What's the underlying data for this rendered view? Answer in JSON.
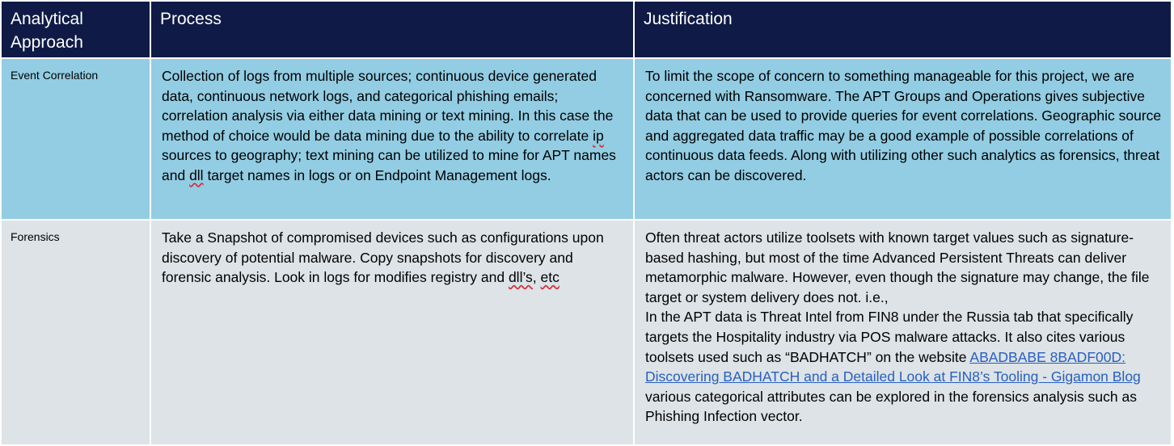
{
  "header": {
    "col1": "Analytical Approach",
    "col2": "Process",
    "col3": "Justification"
  },
  "rows": [
    {
      "approach": "Event Correlation",
      "process": {
        "p1": "Collection of logs from multiple sources; continuous device generated data, continuous network logs, and categorical phishing emails; correlation analysis via either data mining or text mining. In this case the method of choice would be data mining due to the ability to correlate ",
        "ip": "ip",
        "p2": " sources to geography; text mining can be utilized to mine for APT names and ",
        "dll": "dll",
        "p3": " target names in logs or on Endpoint Management logs."
      },
      "justification": "To limit the scope of concern to something manageable for this project, we are concerned with Ransomware. The APT Groups and Operations gives subjective data that can be used to provide queries for event correlations. Geographic source and aggregated data traffic may be a good example of possible correlations of continuous data feeds. Along with utilizing other such analytics as forensics, threat actors can be discovered."
    },
    {
      "approach": "Forensics",
      "process": {
        "p1": "Take a Snapshot of compromised devices such as configurations upon discovery of potential malware. Copy snapshots for discovery and forensic analysis. Look in logs for modifies registry and ",
        "dlls": "dll’s",
        "p2": ", ",
        "etc": "etc"
      },
      "justification": {
        "p1": "Often threat actors utilize toolsets with known target values such as signature-based hashing, but most of the time Advanced Persistent Threats can deliver metamorphic malware. However, even though the signature may change, the file target or system delivery does not. i.e.,",
        "p2": "In the APT data is Threat Intel from FIN8 under the Russia tab that specifically targets the Hospitality industry via POS malware attacks. It also cites various toolsets used such as “BADHATCH” on the website ",
        "link_text": "ABADBABE 8BADF00D: Discovering BADHATCH and a Detailed Look at FIN8’s Tooling - Gigamon Blog",
        "p3": " various categorical attributes can be explored in the forensics analysis such as Phishing Infection vector."
      }
    }
  ],
  "colors": {
    "header_bg": "#0f1b46",
    "row1_bg": "#92cde3",
    "row2_bg": "#dde3e6",
    "link": "#2860c0",
    "spellcheck": "#d0303a"
  }
}
